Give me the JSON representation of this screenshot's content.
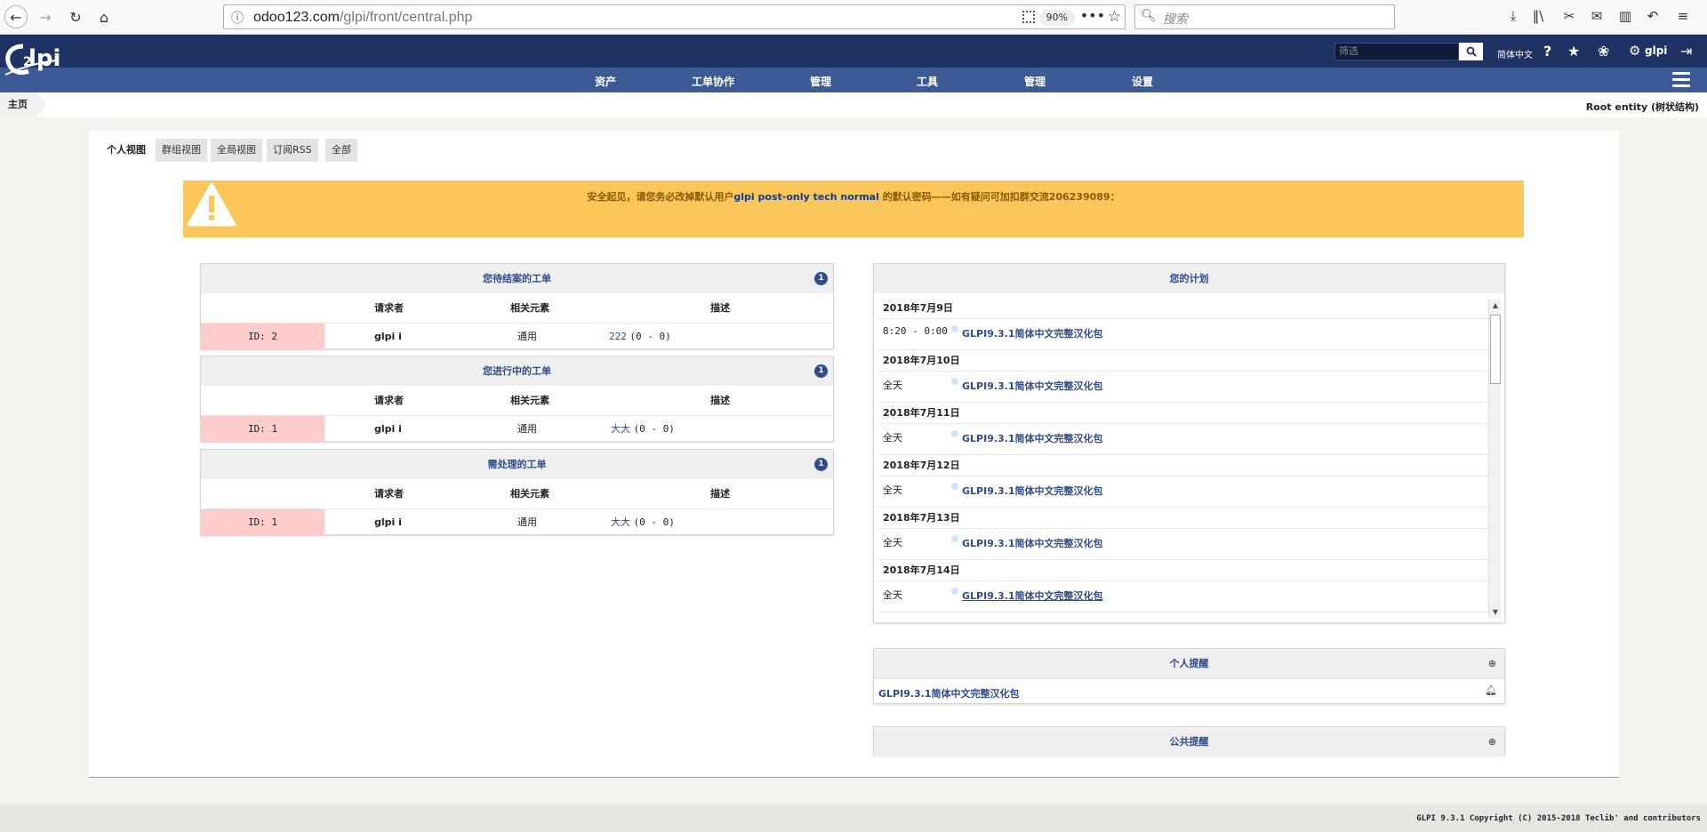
{
  "browser": {
    "url_host": "odoo123.com",
    "url_path": "/glpi/front/central.php",
    "zoom": "90%",
    "search_placeholder": "搜索"
  },
  "header": {
    "search_placeholder": "筛选",
    "language": "简体中文",
    "user": "glpi"
  },
  "menu": [
    "资产",
    "工单协作",
    "管理",
    "工具",
    "管理",
    "设置"
  ],
  "breadcrumb": {
    "home": "主页",
    "entity": "Root entity (树状结构)"
  },
  "tabs": [
    "个人视图",
    "群组视图",
    "全局视图",
    "订阅RSS",
    "全部"
  ],
  "alert": {
    "prefix": "安全起见，请您务必改掉默认用户",
    "users": "glpi post-only tech normal",
    "suffix": " 的默认密码——如有疑问可加扣群交流206239089："
  },
  "ticket_columns": {
    "requester": "请求者",
    "item": "相关元素",
    "description": "描述"
  },
  "ticket_boxes": [
    {
      "title": "您待结案的工单",
      "count": "1",
      "row": {
        "id": "ID: 2",
        "requester": "glpi",
        "item": "通用",
        "desc_link": "222",
        "desc_extra": "(0 - 0)"
      }
    },
    {
      "title": "您进行中的工单",
      "count": "1",
      "row": {
        "id": "ID: 1",
        "requester": "glpi",
        "item": "通用",
        "desc_link": "大大",
        "desc_extra": "(0 - 0)"
      }
    },
    {
      "title": "需处理的工单",
      "count": "1",
      "row": {
        "id": "ID: 1",
        "requester": "glpi",
        "item": "通用",
        "desc_link": "大大",
        "desc_extra": "(0 - 0)"
      }
    }
  ],
  "planning": {
    "title": "您的计划",
    "days": [
      {
        "date": "2018年7月9日",
        "time": "8:20 - 0:00",
        "item": "GLPI9.3.1简体中文完整汉化包"
      },
      {
        "date": "2018年7月10日",
        "time": "全天",
        "item": "GLPI9.3.1简体中文完整汉化包"
      },
      {
        "date": "2018年7月11日",
        "time": "全天",
        "item": "GLPI9.3.1简体中文完整汉化包"
      },
      {
        "date": "2018年7月12日",
        "time": "全天",
        "item": "GLPI9.3.1简体中文完整汉化包"
      },
      {
        "date": "2018年7月13日",
        "time": "全天",
        "item": "GLPI9.3.1简体中文完整汉化包"
      },
      {
        "date": "2018年7月14日",
        "time": "全天",
        "item": "GLPI9.3.1简体中文完整汉化包"
      }
    ]
  },
  "personal_reminders": {
    "title": "个人提醒",
    "item": "GLPI9.3.1简体中文完整汉化包"
  },
  "public_reminders": {
    "title": "公共提醒"
  },
  "footer": "GLPI 9.3.1 Copyright (C) 2015-2018 Teclib' and contributors",
  "colors": {
    "header": "#1e3264",
    "menu": "#3c5a96",
    "alert": "#fbc65a",
    "ticket_id_bg": "#ffcccc",
    "link": "#2f4b8c"
  }
}
